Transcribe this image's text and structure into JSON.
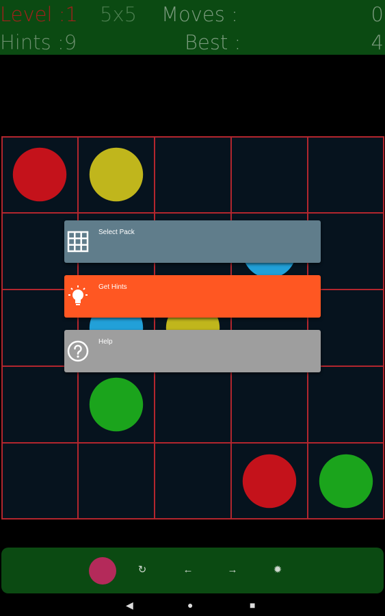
{
  "header": {
    "level_text": "Level :1",
    "size_text": "5x5",
    "moves_label": "Moves :",
    "moves_value": "0",
    "hints_text": "Hints :9",
    "best_label": "Best :",
    "best_value": "4"
  },
  "board": {
    "rows": 5,
    "cols": 5,
    "grid_color": "#b3262e",
    "background": "#06131e",
    "dots": [
      {
        "row": 0,
        "col": 0,
        "color": "#c4121b"
      },
      {
        "row": 0,
        "col": 1,
        "color": "#c0b61c"
      },
      {
        "row": 1,
        "col": 3,
        "color": "#22a0d8"
      },
      {
        "row": 2,
        "col": 1,
        "color": "#22a0d8"
      },
      {
        "row": 2,
        "col": 2,
        "color": "#c0b61c"
      },
      {
        "row": 3,
        "col": 1,
        "color": "#1ba41c"
      },
      {
        "row": 4,
        "col": 3,
        "color": "#c4121b"
      },
      {
        "row": 4,
        "col": 4,
        "color": "#1ba41c"
      }
    ]
  },
  "menu": {
    "items": [
      {
        "label": "Select Pack",
        "icon": "grid-icon",
        "color": "#607d8b"
      },
      {
        "label": "Get Hints",
        "icon": "lightbulb-icon",
        "color": "#ff5722"
      },
      {
        "label": "Help",
        "icon": "help-circle-icon",
        "color": "#9e9e9e"
      }
    ]
  },
  "controls": {
    "selected_color": "#b42a5a",
    "restart_glyph": "↻",
    "undo_glyph": "←",
    "redo_glyph": "→",
    "hint_glyph": "✹"
  },
  "navbar": {
    "back_glyph": "◀",
    "home_glyph": "●",
    "recents_glyph": "■"
  }
}
